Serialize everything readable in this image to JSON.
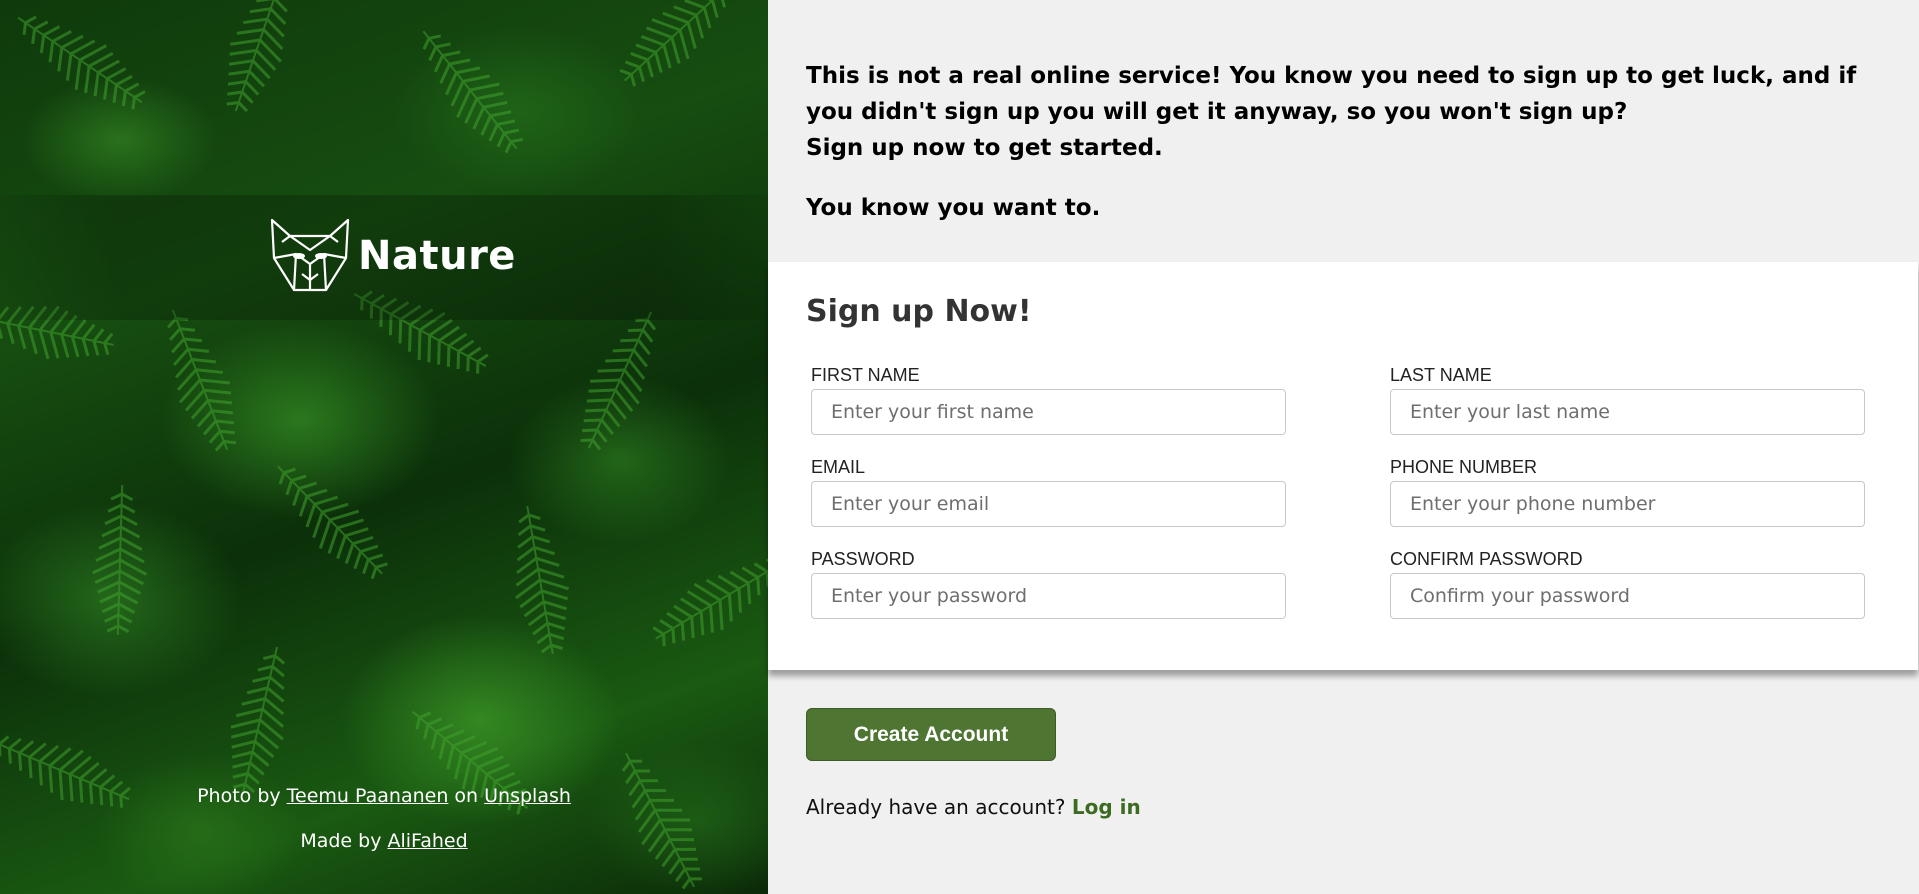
{
  "hero": {
    "brand": "Nature",
    "logo_icon": "fox-mask-icon",
    "credit": {
      "prefix": "Photo by",
      "author": "Teemu Paananen",
      "middle": "on",
      "site": "Unsplash"
    },
    "made_by": {
      "prefix": "Made by",
      "author": "AliFahed"
    }
  },
  "intro": {
    "line1": "This is not a real online service! You know you need to sign up to get luck, and if you didn't sign up you will get it anyway, so you won't sign up?",
    "line2": "Sign up now to get started.",
    "line3": "You know you want to."
  },
  "form": {
    "title": "Sign up Now!",
    "fields": {
      "first_name": {
        "label": "FIRST NAME",
        "placeholder": "Enter your first name"
      },
      "last_name": {
        "label": "LAST NAME",
        "placeholder": "Enter your last name"
      },
      "email": {
        "label": "EMAIL",
        "placeholder": "Enter your email"
      },
      "phone": {
        "label": "PHONE NUMBER",
        "placeholder": "Enter your phone number"
      },
      "password": {
        "label": "PASSWORD",
        "placeholder": "Enter your password"
      },
      "confirm_password": {
        "label": "CONFIRM PASSWORD",
        "placeholder": "Confirm your password"
      }
    },
    "submit_label": "Create Account",
    "login_prompt": "Already have an account?",
    "login_link": "Log in"
  },
  "colors": {
    "accent": "#4e7532",
    "link": "#3d6b22",
    "panel_bg": "#f0f0f0",
    "card_bg": "#ffffff"
  }
}
